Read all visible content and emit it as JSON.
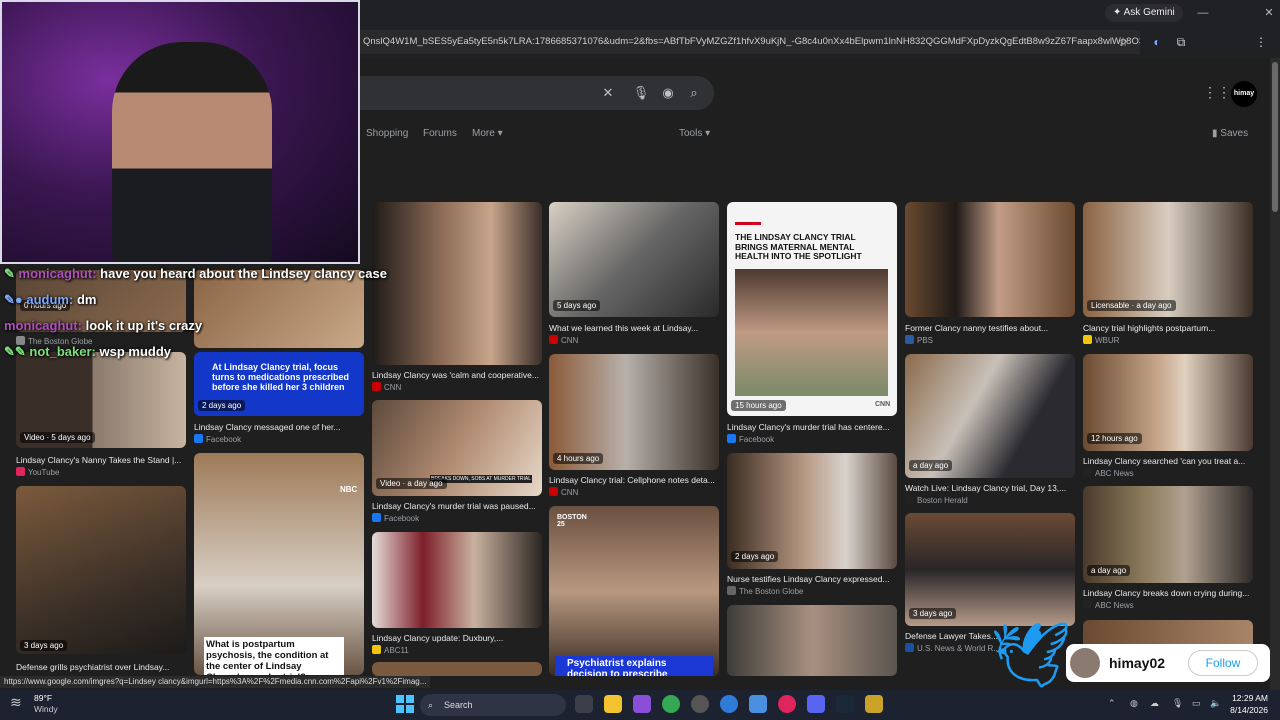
{
  "browser": {
    "ask_gemini_label": "Ask Gemini",
    "url": "QnslQ4W1M_bSES5yEa5tyE5n5k7LRA:1786685371076&udm=2&fbs=ABfTbFVyMZGZf1hfvX9uKjN_-G8c4u0nXx4bElpwm1lnNH832QGGMdFXpDyzkQgEdtB8w9zZ67Faapx8wlWp8O3..."
  },
  "google": {
    "tabs": [
      "Shopping",
      "Forums",
      "More",
      "Tools"
    ],
    "saves_label": "Saves",
    "profile_label": "himay"
  },
  "results": [
    {
      "title": "Lindsay Clancy's Nanny Takes the Stand |...",
      "source": "YouTube",
      "badge": "Video · 5 days ago",
      "overlay": ""
    },
    {
      "title": "Defense grills psychiatrist over Lindsay...",
      "source": "",
      "badge": "3 days ago",
      "overlay": ""
    },
    {
      "title": "Lindsay Clancy messaged one of her...",
      "source": "Facebook",
      "badge": "2 days ago",
      "overlay": "At Lindsay Clancy trial, focus turns to medications prescribed before she killed her 3 children"
    },
    {
      "title": "",
      "source": "",
      "badge": "",
      "overlay": "What is postpartum psychosis, the condition at the center of Lindsay Clancy's murder trial?"
    },
    {
      "title": "Lindsay Clancy was 'calm and cooperative...",
      "source": "CNN",
      "badge": "",
      "overlay": ""
    },
    {
      "title": "Lindsay Clancy's murder trial was paused...",
      "source": "Facebook",
      "badge": "Video · a day ago",
      "overlay": ""
    },
    {
      "title": "Lindsay Clancy update: Duxbury,...",
      "source": "ABC11",
      "badge": "",
      "overlay": ""
    },
    {
      "title": "What we learned this week at Lindsay...",
      "source": "CNN",
      "badge": "5 days ago",
      "overlay": ""
    },
    {
      "title": "Lindsay Clancy trial: Cellphone notes deta...",
      "source": "CNN",
      "badge": "4 hours ago",
      "overlay": ""
    },
    {
      "title": "",
      "source": "",
      "badge": "",
      "overlay": "Psychiatrist explains decision to prescribe"
    },
    {
      "title": "Lindsay Clancy's murder trial has centere...",
      "source": "Facebook",
      "badge": "15 hours ago",
      "overlay": "THE LINDSAY CLANCY TRIAL BRINGS MATERNAL MENTAL HEALTH INTO THE SPOTLIGHT"
    },
    {
      "title": "Nurse testifies Lindsay Clancy expressed...",
      "source": "The Boston Globe",
      "badge": "2 days ago",
      "overlay": ""
    },
    {
      "title": "Former Clancy nanny testifies about...",
      "source": "PBS",
      "badge": "",
      "overlay": ""
    },
    {
      "title": "Watch Live: Lindsay Clancy trial, Day 13,...",
      "source": "Boston Herald",
      "badge": "a day ago",
      "overlay": ""
    },
    {
      "title": "Defense Lawyer Takes...",
      "source": "U.S. News & World R...",
      "badge": "3 days ago",
      "overlay": ""
    },
    {
      "title": "Clancy trial highlights postpartum...",
      "source": "WBUR",
      "badge": "Licensable · a day ago",
      "overlay": ""
    },
    {
      "title": "Lindsay Clancy searched 'can you treat a...",
      "source": "ABC News",
      "badge": "12 hours ago",
      "overlay": ""
    },
    {
      "title": "Lindsay Clancy breaks down crying during...",
      "source": "ABC News",
      "badge": "a day ago",
      "overlay": ""
    }
  ],
  "partial_labels": {
    "boston_globe": "The Boston Globe",
    "hours_ago": "0 hours ago",
    "sobs_caption": "BREAKS DOWN, SOBS AT MURDER TRIAL",
    "boston25": "BOSTON 25",
    "cnn_logo": "CNN",
    "nbc_logo": "NBC"
  },
  "chat": [
    {
      "user": "monicaghut:",
      "message": "have you heard about the Lindsey clancy case",
      "color": "#b050c0"
    },
    {
      "user": "audum:",
      "message": "dm",
      "color": "#7aa8ff"
    },
    {
      "user": "monicaghut:",
      "message": "look it up it's crazy",
      "color": "#b050c0"
    },
    {
      "user": "not_baker:",
      "message": "wsp muddy",
      "color": "#7be07b"
    }
  ],
  "twitter": {
    "handle": "himay02",
    "follow_label": "Follow"
  },
  "status_url": "https://www.google.com/imgres?q=Lindsey clancy&imgurl=https%3A%2F%2Fmedia.cnn.com%2Fapi%2Fv1%2Fimag...",
  "taskbar": {
    "temp": "89°F",
    "condition": "Windy",
    "search_label": "Search",
    "time": "12:29 AM",
    "date": "8/14/2026"
  },
  "colors": {
    "accent_blue": "#1d9bf0",
    "page_bg": "#1f1f1f",
    "chrome_bg": "#202124"
  }
}
